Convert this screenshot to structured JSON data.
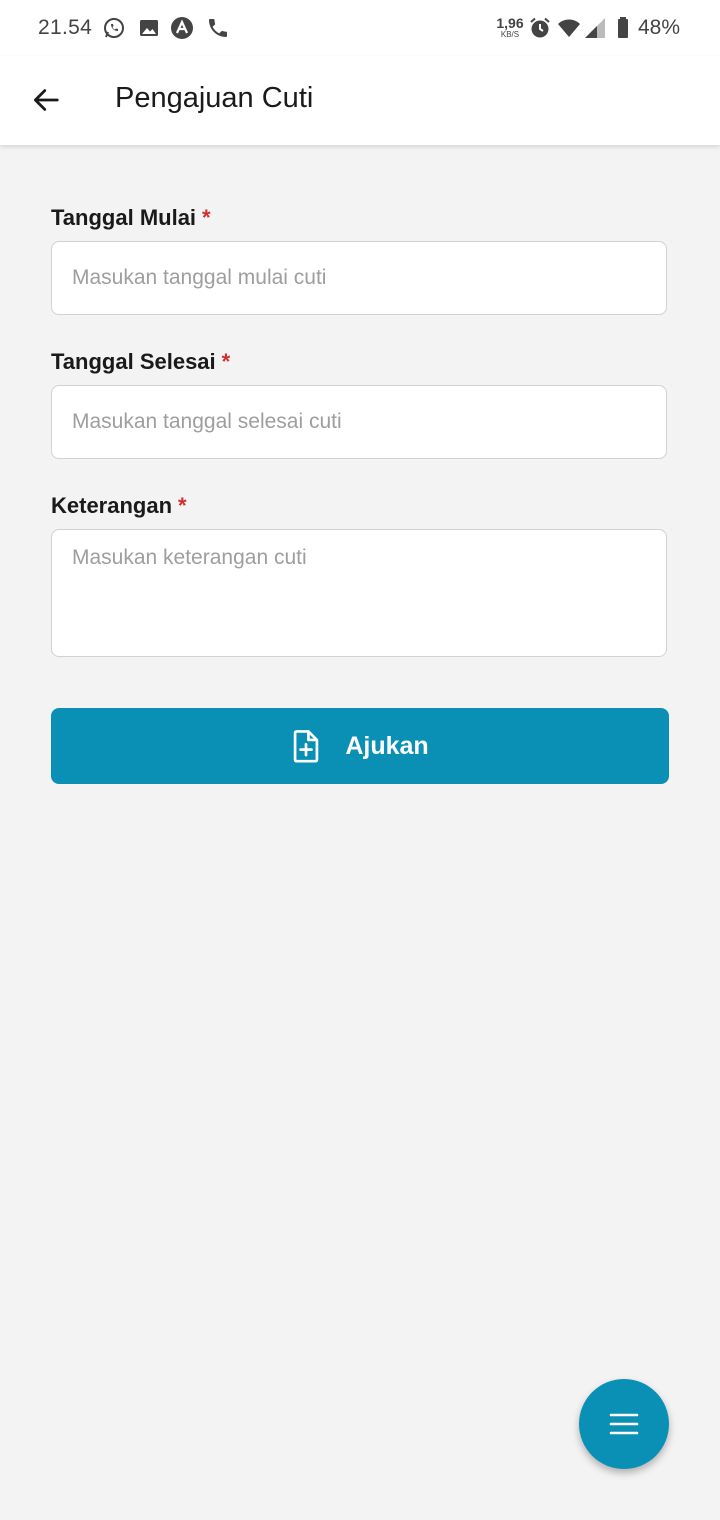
{
  "status_bar": {
    "time": "21.54",
    "network_speed_value": "1,96",
    "network_speed_unit": "KB/S",
    "battery_percent": "48%",
    "icons": [
      "whatsapp-icon",
      "gallery-icon",
      "app-icon",
      "phone-icon",
      "alarm-icon",
      "wifi-icon",
      "signal-icon",
      "battery-icon"
    ]
  },
  "appbar": {
    "title": "Pengajuan Cuti",
    "back_icon": "arrow-left-icon"
  },
  "form": {
    "start_date": {
      "label": "Tanggal Mulai",
      "required_mark": "*",
      "value": "",
      "placeholder": "Masukan tanggal mulai cuti"
    },
    "end_date": {
      "label": "Tanggal Selesai",
      "required_mark": "*",
      "value": "",
      "placeholder": "Masukan tanggal selesai cuti"
    },
    "description": {
      "label": "Keterangan",
      "required_mark": "*",
      "value": "",
      "placeholder": "Masukan keterangan cuti"
    },
    "submit": {
      "label": "Ajukan",
      "icon": "file-plus-icon"
    }
  },
  "fab": {
    "icon": "menu-icon"
  },
  "colors": {
    "accent": "#0a90b5",
    "background": "#f3f3f3",
    "required": "#d32f2f",
    "placeholder": "#9e9e9e"
  }
}
